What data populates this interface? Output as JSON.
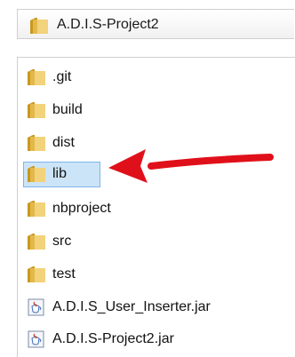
{
  "path_bar": {
    "label": "A.D.I.S-Project2",
    "icon": "folder-icon"
  },
  "files": [
    {
      "label": ".git",
      "icon": "folder-icon",
      "selected": false
    },
    {
      "label": "build",
      "icon": "folder-icon",
      "selected": false
    },
    {
      "label": "dist",
      "icon": "folder-icon",
      "selected": false
    },
    {
      "label": "lib",
      "icon": "folder-icon",
      "selected": true
    },
    {
      "label": "nbproject",
      "icon": "folder-icon",
      "selected": false
    },
    {
      "label": "src",
      "icon": "folder-icon",
      "selected": false
    },
    {
      "label": "test",
      "icon": "folder-icon",
      "selected": false
    },
    {
      "label": "A.D.I.S_User_Inserter.jar",
      "icon": "jar-file-icon",
      "selected": false
    },
    {
      "label": "A.D.I.S-Project2.jar",
      "icon": "jar-file-icon",
      "selected": false
    }
  ],
  "annotation": {
    "icon": "red-arrow-icon",
    "color": "#e0101a"
  },
  "colors": {
    "folder": "#e8c25a",
    "folder_dark": "#c9981f",
    "selection_bg": "#cce4f7",
    "selection_border": "#7eb4ea"
  }
}
